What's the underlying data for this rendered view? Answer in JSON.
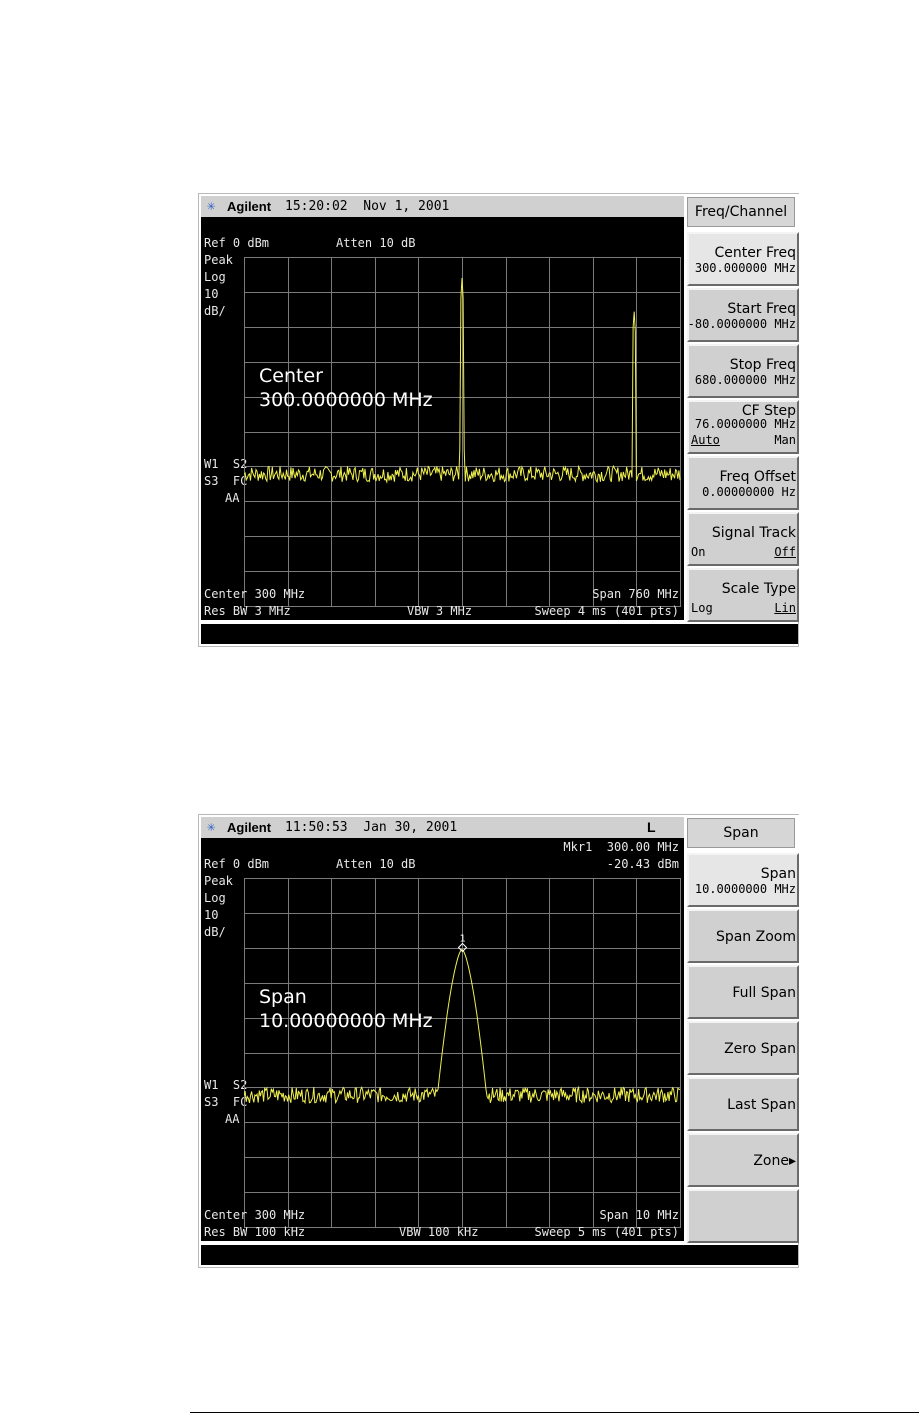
{
  "screens": [
    {
      "brand": "Agilent",
      "clock": "15:20:02  Nov 1, 2001",
      "ref": "Ref 0 dBm",
      "atten": "Atten 10 dB",
      "scale": [
        "Peak",
        "Log",
        "10",
        "dB/"
      ],
      "trace_flags": [
        "W1  S2",
        "S3  FC",
        "AA"
      ],
      "entry_label": "Center",
      "entry_value": "300.0000000 MHz",
      "bottom_left": "Center 300 MHz",
      "bottom_right": "Span 760 MHz",
      "rbw": "Res BW 3 MHz",
      "vbw": "VBW 3 MHz",
      "sweep": "Sweep 4 ms (401 pts)",
      "menu_title": "Freq/Channel",
      "softkeys": [
        {
          "label": "Center Freq",
          "value": "300.000000 MHz",
          "active": true
        },
        {
          "label": "Start Freq",
          "value": "-80.0000000 MHz"
        },
        {
          "label": "Stop Freq",
          "value": "680.000000 MHz"
        },
        {
          "label": "CF Step",
          "value": "76.0000000 MHz",
          "left": "Auto",
          "right": "Man"
        },
        {
          "label": "Freq Offset",
          "value": "0.00000000 Hz"
        },
        {
          "label": "Signal Track",
          "left": "On",
          "right": "Off"
        },
        {
          "label": "Scale Type",
          "left": "Log",
          "right": "Lin"
        }
      ],
      "trace": {
        "type": "two-signal",
        "noise_floor_dB": -62,
        "peaks": [
          {
            "freq_MHz": 300,
            "level_dB": -6
          },
          {
            "freq_MHz": 600,
            "level_dB": -15
          }
        ]
      }
    },
    {
      "brand": "Agilent",
      "clock": "11:50:53  Jan 30, 2001",
      "flag": "L",
      "marker_freq": "Mkr1  300.00 MHz",
      "marker_level": "-20.43 dBm",
      "marker_id": "1",
      "ref": "Ref 0 dBm",
      "atten": "Atten 10 dB",
      "scale": [
        "Peak",
        "Log",
        "10",
        "dB/"
      ],
      "trace_flags": [
        "W1  S2",
        "S3  FC",
        "AA"
      ],
      "entry_label": "Span",
      "entry_value": "10.00000000 MHz",
      "bottom_left": "Center 300 MHz",
      "bottom_right": "Span 10 MHz",
      "rbw": "Res BW 100 kHz",
      "vbw": "VBW 100 kHz",
      "sweep": "Sweep 5 ms (401 pts)",
      "menu_title": "Span",
      "softkeys": [
        {
          "label": "Span",
          "value": "10.0000000 MHz",
          "active": true
        },
        {
          "label": "Span Zoom"
        },
        {
          "label": "Full Span"
        },
        {
          "label": "Zero Span"
        },
        {
          "label": "Last Span"
        },
        {
          "label": "Zone▸"
        },
        {
          "label": ""
        }
      ],
      "trace": {
        "type": "single-peak",
        "noise_floor_dB": -62,
        "peaks": [
          {
            "freq_MHz": 300,
            "level_dB": -20.43
          }
        ]
      }
    }
  ]
}
